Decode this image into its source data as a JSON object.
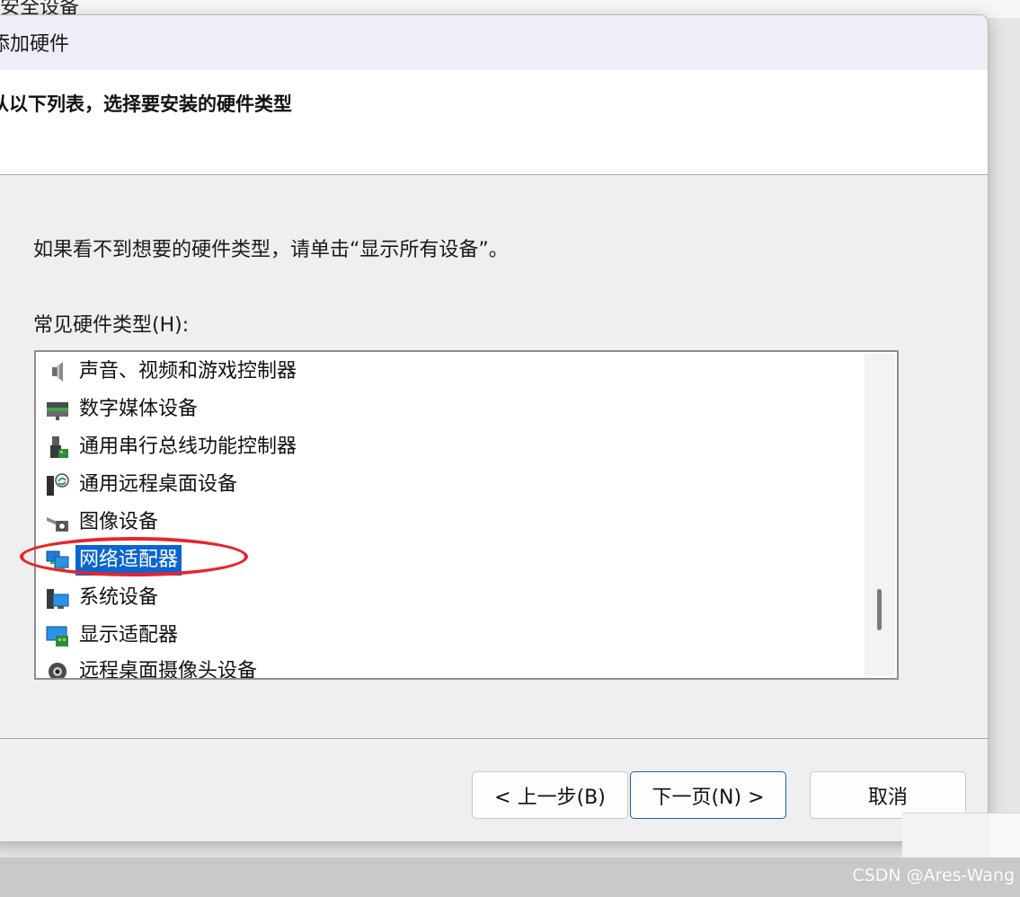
{
  "background": {
    "top_label": "安全设备",
    "watermark": "CSDN @Ares-Wang"
  },
  "dialog": {
    "title": "添加硬件",
    "header_title": "从以下列表，选择要安装的硬件类型",
    "hint": "如果看不到想要的硬件类型，请单击“显示所有设备”。",
    "list_label": "常见硬件类型(H):",
    "items": [
      {
        "label": "声音、视频和游戏控制器",
        "icon": "speaker-icon"
      },
      {
        "label": "数字媒体设备",
        "icon": "media-device-icon"
      },
      {
        "label": "通用串行总线功能控制器",
        "icon": "usb-controller-icon"
      },
      {
        "label": "通用远程桌面设备",
        "icon": "remote-desktop-icon"
      },
      {
        "label": "图像设备",
        "icon": "camera-icon"
      },
      {
        "label": "网络适配器",
        "icon": "network-adapter-icon",
        "selected": true
      },
      {
        "label": "系统设备",
        "icon": "system-device-icon"
      },
      {
        "label": "显示适配器",
        "icon": "display-adapter-icon"
      },
      {
        "label": "远程桌面摄像头设备",
        "icon": "webcam-icon"
      }
    ],
    "buttons": {
      "back": "< 上一步(B)",
      "next": "下一页(N) >",
      "cancel": "取消"
    }
  },
  "colors": {
    "selection": "#0a64d2",
    "annotation": "#e8242a"
  }
}
